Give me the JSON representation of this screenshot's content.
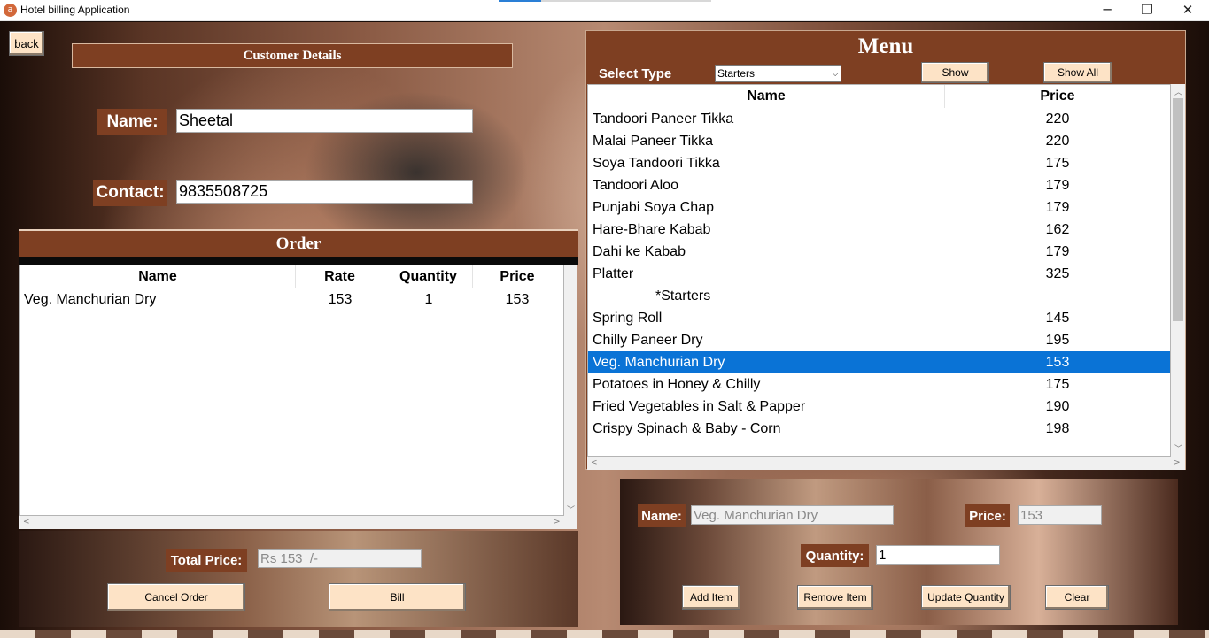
{
  "window": {
    "title": "Hotel billing Application",
    "app_icon": "a",
    "minimize": "─",
    "restore": "❐",
    "close": "✕"
  },
  "nav": {
    "back_label": "back"
  },
  "customer": {
    "header": "Customer Details",
    "name_label": "Name:",
    "name_value": "Sheetal",
    "contact_label": "Contact:",
    "contact_value": "9835508725"
  },
  "order": {
    "title": "Order",
    "columns": [
      "Name",
      "Rate",
      "Quantity",
      "Price"
    ],
    "rows": [
      {
        "name": "Veg. Manchurian Dry",
        "rate": "153",
        "quantity": "1",
        "price": "153"
      }
    ],
    "total_label": "Total Price:",
    "total_value": "Rs 153  /-",
    "cancel_label": "Cancel Order",
    "bill_label": "Bill"
  },
  "menu": {
    "title": "Menu",
    "select_type_label": "Select Type",
    "select_value": "Starters",
    "show_label": "Show",
    "show_all_label": "Show All",
    "columns": [
      "Name",
      "Price"
    ],
    "items": [
      {
        "name": "Tandoori Paneer Tikka",
        "price": "220"
      },
      {
        "name": "Malai Paneer Tikka",
        "price": "220"
      },
      {
        "name": "Soya Tandoori Tikka",
        "price": "175"
      },
      {
        "name": "Tandoori Aloo",
        "price": "179"
      },
      {
        "name": "Punjabi Soya Chap",
        "price": "179"
      },
      {
        "name": "Hare-Bhare Kabab",
        "price": "162"
      },
      {
        "name": "Dahi ke Kabab",
        "price": "179"
      },
      {
        "name": "Platter",
        "price": "325"
      },
      {
        "name": "*Starters",
        "price": ""
      },
      {
        "name": "Spring Roll",
        "price": "145"
      },
      {
        "name": "Chilly Paneer Dry",
        "price": "195"
      },
      {
        "name": "Veg. Manchurian Dry",
        "price": "153",
        "selected": true
      },
      {
        "name": "Potatoes in Honey & Chilly",
        "price": "175"
      },
      {
        "name": "Fried Vegetables in Salt & Papper",
        "price": "190"
      },
      {
        "name": "Crispy Spinach & Baby - Corn",
        "price": "198"
      }
    ]
  },
  "item_detail": {
    "name_label": "Name:",
    "name_value": "Veg. Manchurian Dry",
    "price_label": "Price:",
    "price_value": "153",
    "quantity_label": "Quantity:",
    "quantity_value": "1",
    "add_label": "Add Item",
    "remove_label": "Remove Item",
    "update_label": "Update Quantity",
    "clear_label": "Clear"
  },
  "colors": {
    "accent_brown": "#7e3f22",
    "button_face": "#fde3c6",
    "selection_blue": "#0a73d6"
  }
}
